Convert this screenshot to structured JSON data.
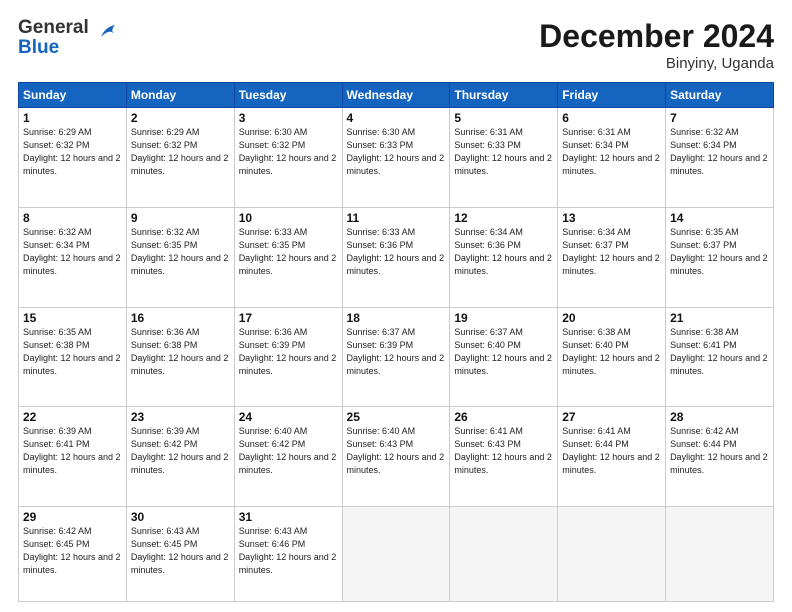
{
  "logo": {
    "general": "General",
    "blue": "Blue"
  },
  "title": "December 2024",
  "location": "Binyiny, Uganda",
  "days_header": [
    "Sunday",
    "Monday",
    "Tuesday",
    "Wednesday",
    "Thursday",
    "Friday",
    "Saturday"
  ],
  "weeks": [
    [
      {
        "day": "1",
        "sunrise": "6:29 AM",
        "sunset": "6:32 PM",
        "daylight": "12 hours and 2 minutes."
      },
      {
        "day": "2",
        "sunrise": "6:29 AM",
        "sunset": "6:32 PM",
        "daylight": "12 hours and 2 minutes."
      },
      {
        "day": "3",
        "sunrise": "6:30 AM",
        "sunset": "6:32 PM",
        "daylight": "12 hours and 2 minutes."
      },
      {
        "day": "4",
        "sunrise": "6:30 AM",
        "sunset": "6:33 PM",
        "daylight": "12 hours and 2 minutes."
      },
      {
        "day": "5",
        "sunrise": "6:31 AM",
        "sunset": "6:33 PM",
        "daylight": "12 hours and 2 minutes."
      },
      {
        "day": "6",
        "sunrise": "6:31 AM",
        "sunset": "6:34 PM",
        "daylight": "12 hours and 2 minutes."
      },
      {
        "day": "7",
        "sunrise": "6:32 AM",
        "sunset": "6:34 PM",
        "daylight": "12 hours and 2 minutes."
      }
    ],
    [
      {
        "day": "8",
        "sunrise": "6:32 AM",
        "sunset": "6:34 PM",
        "daylight": "12 hours and 2 minutes."
      },
      {
        "day": "9",
        "sunrise": "6:32 AM",
        "sunset": "6:35 PM",
        "daylight": "12 hours and 2 minutes."
      },
      {
        "day": "10",
        "sunrise": "6:33 AM",
        "sunset": "6:35 PM",
        "daylight": "12 hours and 2 minutes."
      },
      {
        "day": "11",
        "sunrise": "6:33 AM",
        "sunset": "6:36 PM",
        "daylight": "12 hours and 2 minutes."
      },
      {
        "day": "12",
        "sunrise": "6:34 AM",
        "sunset": "6:36 PM",
        "daylight": "12 hours and 2 minutes."
      },
      {
        "day": "13",
        "sunrise": "6:34 AM",
        "sunset": "6:37 PM",
        "daylight": "12 hours and 2 minutes."
      },
      {
        "day": "14",
        "sunrise": "6:35 AM",
        "sunset": "6:37 PM",
        "daylight": "12 hours and 2 minutes."
      }
    ],
    [
      {
        "day": "15",
        "sunrise": "6:35 AM",
        "sunset": "6:38 PM",
        "daylight": "12 hours and 2 minutes."
      },
      {
        "day": "16",
        "sunrise": "6:36 AM",
        "sunset": "6:38 PM",
        "daylight": "12 hours and 2 minutes."
      },
      {
        "day": "17",
        "sunrise": "6:36 AM",
        "sunset": "6:39 PM",
        "daylight": "12 hours and 2 minutes."
      },
      {
        "day": "18",
        "sunrise": "6:37 AM",
        "sunset": "6:39 PM",
        "daylight": "12 hours and 2 minutes."
      },
      {
        "day": "19",
        "sunrise": "6:37 AM",
        "sunset": "6:40 PM",
        "daylight": "12 hours and 2 minutes."
      },
      {
        "day": "20",
        "sunrise": "6:38 AM",
        "sunset": "6:40 PM",
        "daylight": "12 hours and 2 minutes."
      },
      {
        "day": "21",
        "sunrise": "6:38 AM",
        "sunset": "6:41 PM",
        "daylight": "12 hours and 2 minutes."
      }
    ],
    [
      {
        "day": "22",
        "sunrise": "6:39 AM",
        "sunset": "6:41 PM",
        "daylight": "12 hours and 2 minutes."
      },
      {
        "day": "23",
        "sunrise": "6:39 AM",
        "sunset": "6:42 PM",
        "daylight": "12 hours and 2 minutes."
      },
      {
        "day": "24",
        "sunrise": "6:40 AM",
        "sunset": "6:42 PM",
        "daylight": "12 hours and 2 minutes."
      },
      {
        "day": "25",
        "sunrise": "6:40 AM",
        "sunset": "6:43 PM",
        "daylight": "12 hours and 2 minutes."
      },
      {
        "day": "26",
        "sunrise": "6:41 AM",
        "sunset": "6:43 PM",
        "daylight": "12 hours and 2 minutes."
      },
      {
        "day": "27",
        "sunrise": "6:41 AM",
        "sunset": "6:44 PM",
        "daylight": "12 hours and 2 minutes."
      },
      {
        "day": "28",
        "sunrise": "6:42 AM",
        "sunset": "6:44 PM",
        "daylight": "12 hours and 2 minutes."
      }
    ],
    [
      {
        "day": "29",
        "sunrise": "6:42 AM",
        "sunset": "6:45 PM",
        "daylight": "12 hours and 2 minutes."
      },
      {
        "day": "30",
        "sunrise": "6:43 AM",
        "sunset": "6:45 PM",
        "daylight": "12 hours and 2 minutes."
      },
      {
        "day": "31",
        "sunrise": "6:43 AM",
        "sunset": "6:46 PM",
        "daylight": "12 hours and 2 minutes."
      },
      null,
      null,
      null,
      null
    ]
  ]
}
